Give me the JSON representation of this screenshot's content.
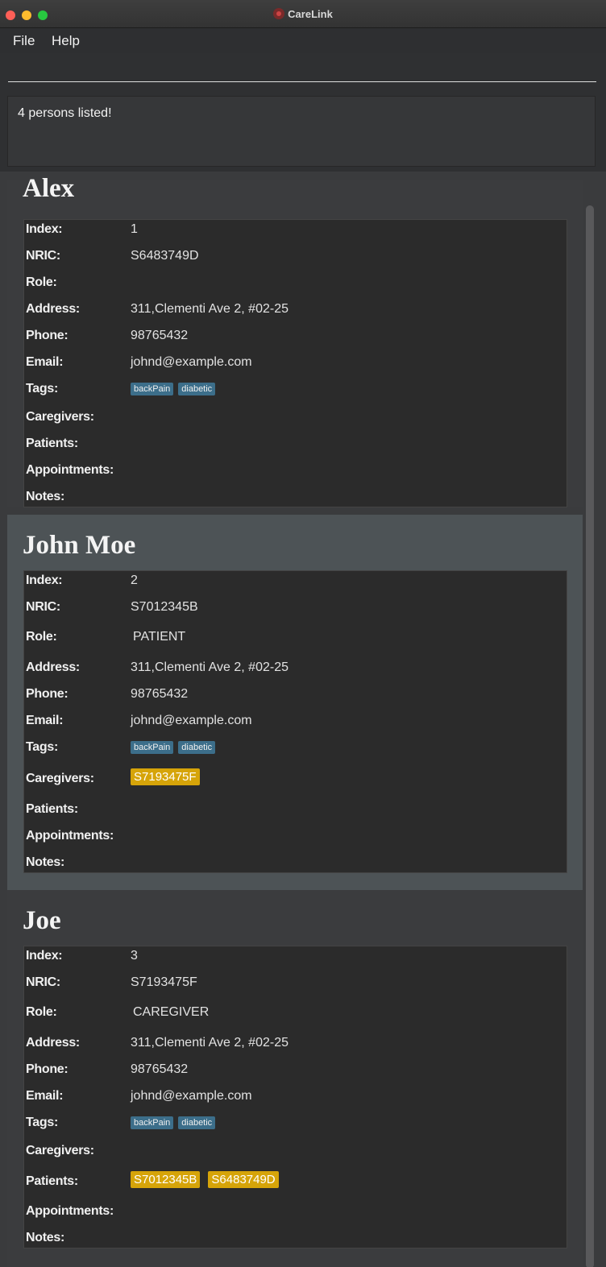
{
  "window": {
    "title": "CareLink"
  },
  "menu": {
    "file": "File",
    "help": "Help"
  },
  "command": {
    "value": "",
    "placeholder": ""
  },
  "result": {
    "message": "4 persons listed!"
  },
  "labels": {
    "index": "Index:",
    "nric": "NRIC:",
    "role": "Role:",
    "address": "Address:",
    "phone": "Phone:",
    "email": "Email:",
    "tags": "Tags:",
    "caregivers": "Caregivers:",
    "patients": "Patients:",
    "appointments": "Appointments:",
    "notes": "Notes:"
  },
  "persons": [
    {
      "name": "Alex",
      "index": "1",
      "nric": "S6483749D",
      "role": "",
      "address": "311,Clementi Ave 2, #02-25",
      "phone": "98765432",
      "email": "johnd@example.com",
      "tags": [
        "backPain",
        "diabetic"
      ],
      "caregivers": [],
      "patients": []
    },
    {
      "name": "John Moe",
      "index": "2",
      "nric": "S7012345B",
      "role": "PATIENT",
      "address": "311,Clementi Ave 2, #02-25",
      "phone": "98765432",
      "email": "johnd@example.com",
      "tags": [
        "backPain",
        "diabetic"
      ],
      "caregivers": [
        "S7193475F"
      ],
      "patients": []
    },
    {
      "name": "Joe",
      "index": "3",
      "nric": "S7193475F",
      "role": "CAREGIVER",
      "address": "311,Clementi Ave 2, #02-25",
      "phone": "98765432",
      "email": "johnd@example.com",
      "tags": [
        "backPain",
        "diabetic"
      ],
      "caregivers": [],
      "patients": [
        "S7012345B",
        "S6483749D"
      ]
    }
  ]
}
